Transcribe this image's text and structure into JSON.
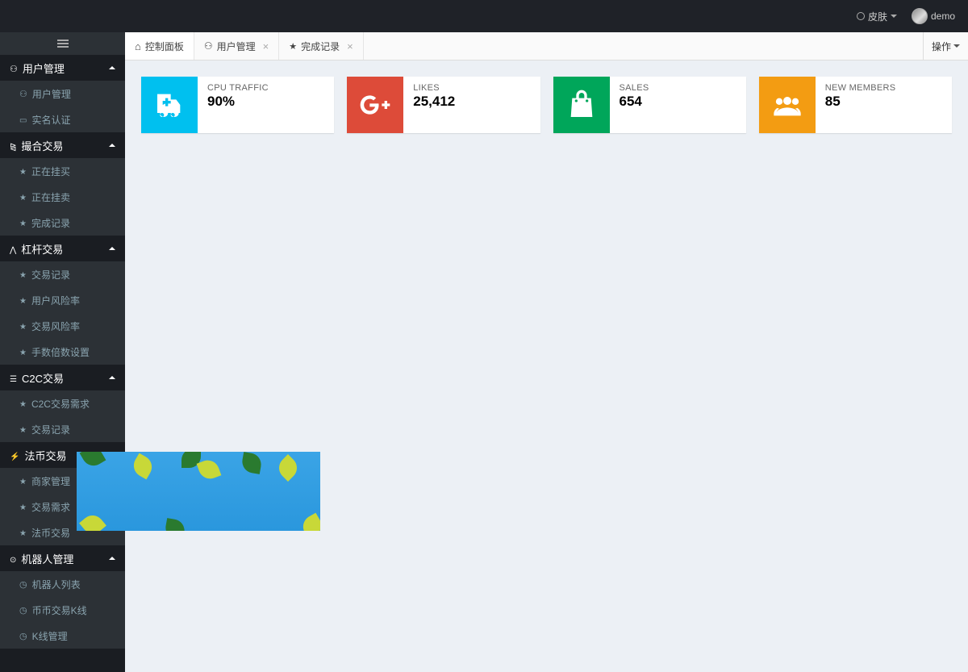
{
  "header": {
    "skin_label": "皮肤",
    "username": "demo"
  },
  "sidebar": {
    "groups": [
      {
        "icon": "user-icon",
        "label": "用户管理",
        "items": [
          {
            "icon": "user-icon",
            "label": "用户管理"
          },
          {
            "icon": "card-icon",
            "label": "实名认证"
          }
        ]
      },
      {
        "icon": "chart-icon",
        "label": "撮合交易",
        "items": [
          {
            "icon": "star-icon",
            "label": "正在挂买"
          },
          {
            "icon": "star-icon",
            "label": "正在挂卖"
          },
          {
            "icon": "star-icon",
            "label": "完成记录"
          }
        ]
      },
      {
        "icon": "pulse-icon",
        "label": "杠杆交易",
        "items": [
          {
            "icon": "star-icon",
            "label": "交易记录"
          },
          {
            "icon": "star-icon",
            "label": "用户风险率"
          },
          {
            "icon": "star-icon",
            "label": "交易风险率"
          },
          {
            "icon": "star-icon",
            "label": "手数倍数设置"
          }
        ]
      },
      {
        "icon": "msg-icon",
        "label": "C2C交易",
        "items": [
          {
            "icon": "star-icon",
            "label": "C2C交易需求"
          },
          {
            "icon": "star-icon",
            "label": "交易记录"
          }
        ]
      },
      {
        "icon": "flash-icon",
        "label": "法币交易",
        "items": [
          {
            "icon": "star-icon",
            "label": "商家管理"
          },
          {
            "icon": "star-icon",
            "label": "交易需求"
          },
          {
            "icon": "star-icon",
            "label": "法币交易"
          }
        ]
      },
      {
        "icon": "headset-icon",
        "label": "机器人管理",
        "items": [
          {
            "icon": "clock-icon",
            "label": "机器人列表"
          },
          {
            "icon": "clock-icon",
            "label": "币币交易K线"
          },
          {
            "icon": "clock-icon",
            "label": "K线管理"
          }
        ]
      }
    ]
  },
  "tabs": {
    "items": [
      {
        "icon": "home-icon",
        "label": "控制面板",
        "closable": false,
        "active": true
      },
      {
        "icon": "user-tab-icon",
        "label": "用户管理",
        "closable": true,
        "active": false
      },
      {
        "icon": "star-tab-icon",
        "label": "完成记录",
        "closable": true,
        "active": false
      }
    ],
    "actions_label": "操作"
  },
  "cards": [
    {
      "label": "CPU TRAFFIC",
      "value": "90%",
      "color": "bg-blue",
      "icon": "ambulance"
    },
    {
      "label": "LIKES",
      "value": "25,412",
      "color": "bg-red",
      "icon": "gplus"
    },
    {
      "label": "SALES",
      "value": "654",
      "color": "bg-green",
      "icon": "bag"
    },
    {
      "label": "NEW MEMBERS",
      "value": "85",
      "color": "bg-orange",
      "icon": "users"
    }
  ]
}
